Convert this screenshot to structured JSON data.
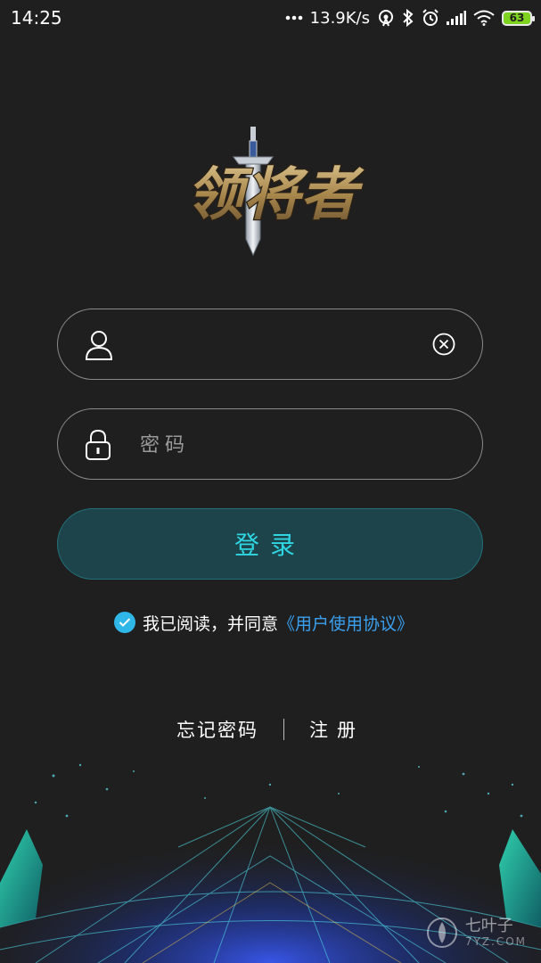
{
  "status_bar": {
    "time": "14:25",
    "network_speed": "13.9K/s",
    "battery_level": "63",
    "icons": [
      "more-dots-icon",
      "hotspot-icon",
      "bluetooth-icon",
      "alarm-icon",
      "signal-icon",
      "wifi-icon",
      "battery-icon"
    ]
  },
  "logo": {
    "text": "领将者",
    "colors": {
      "gold": "#b89a5a",
      "blade": "#d8dde4",
      "hilt": "#3a5b9a"
    }
  },
  "username": {
    "value": "",
    "placeholder": ""
  },
  "password": {
    "value": "",
    "placeholder": "密码"
  },
  "login": {
    "label": "登录"
  },
  "agreement": {
    "checked": true,
    "text": "我已阅读，并同意",
    "link": "《用户使用协议》"
  },
  "links": {
    "forgot_password": "忘记密码",
    "register": "注册"
  },
  "watermark": {
    "text": "七叶子",
    "sub": "7YZ.COM"
  },
  "colors": {
    "background": "#1f1f1f",
    "accent": "#2fd6e3",
    "button_bg": "#1c444a",
    "link": "#3aa0f0",
    "check": "#2fb7e8"
  }
}
